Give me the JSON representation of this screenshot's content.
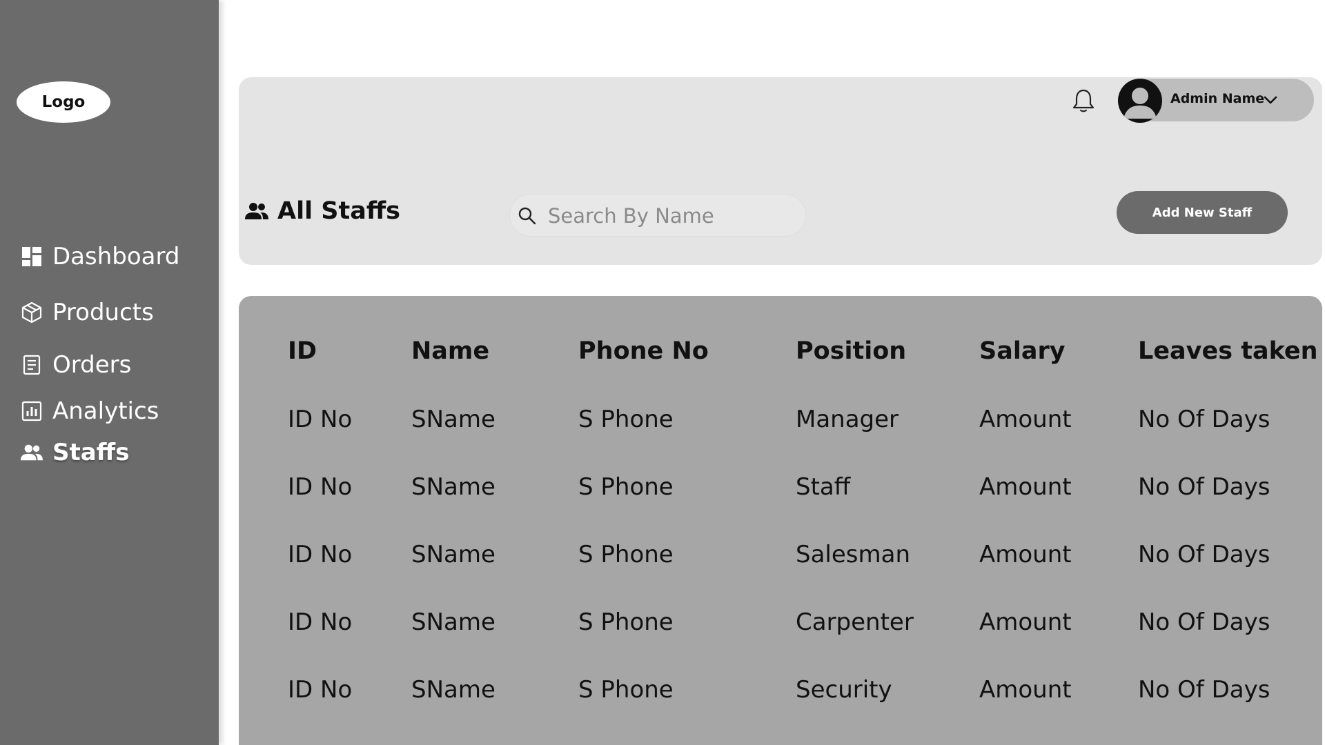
{
  "sidebar": {
    "logo": "Logo",
    "items": [
      {
        "label": "Dashboard",
        "icon": "dashboard-icon"
      },
      {
        "label": "Products",
        "icon": "box-icon"
      },
      {
        "label": "Orders",
        "icon": "document-icon"
      },
      {
        "label": "Analytics",
        "icon": "chart-icon"
      },
      {
        "label": "Staffs",
        "icon": "people-icon",
        "active": true
      }
    ]
  },
  "header": {
    "admin_name": "Admin Name",
    "page_title": "All Staffs",
    "search_placeholder": "Search By Name",
    "add_button": "Add New Staff"
  },
  "table": {
    "columns": [
      "ID",
      "Name",
      "Phone No",
      "Position",
      "Salary",
      "Leaves taken"
    ],
    "rows": [
      [
        "ID No",
        "SName",
        "S Phone",
        "Manager",
        "Amount",
        "No Of Days"
      ],
      [
        "ID No",
        "SName",
        "S Phone",
        "Staff",
        "Amount",
        "No Of Days"
      ],
      [
        "ID No",
        "SName",
        "S Phone",
        "Salesman",
        "Amount",
        "No Of Days"
      ],
      [
        "ID No",
        "SName",
        "S Phone",
        "Carpenter",
        "Amount",
        "No Of Days"
      ],
      [
        "ID No",
        "SName",
        "S Phone",
        "Security",
        "Amount",
        "No Of Days"
      ]
    ]
  },
  "colors": {
    "sidebar": "#6b6b6b",
    "header_card": "#e4e4e4",
    "table_card": "#a6a6a6",
    "button": "#6b6b6b"
  }
}
